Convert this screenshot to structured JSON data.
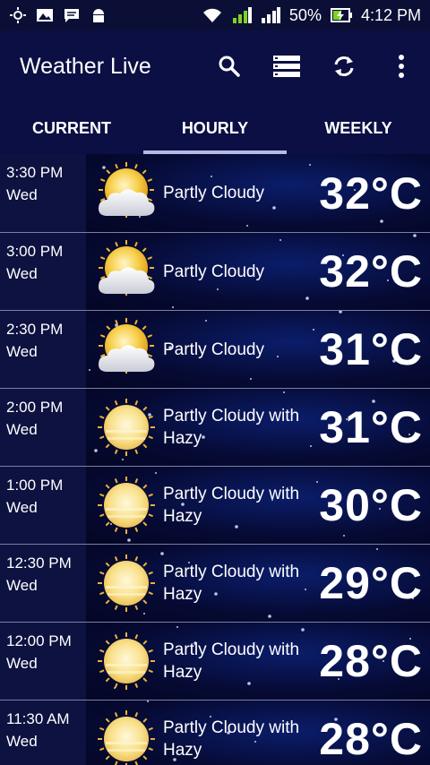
{
  "status_bar": {
    "battery": "50%",
    "time": "4:12 PM"
  },
  "app_bar": {
    "title": "Weather Live",
    "actions": [
      "search-icon",
      "list-icon",
      "refresh-icon",
      "more-vertical-icon"
    ]
  },
  "tabs": [
    {
      "label": "CURRENT",
      "active": false
    },
    {
      "label": "HOURLY",
      "active": true
    },
    {
      "label": "WEEKLY",
      "active": false
    }
  ],
  "hourly": [
    {
      "time": "3:30 PM",
      "day": "Wed",
      "condition": "Partly Cloudy",
      "temp": "32°C",
      "icon": "partly-cloudy-icon"
    },
    {
      "time": "3:00 PM",
      "day": "Wed",
      "condition": "Partly Cloudy",
      "temp": "32°C",
      "icon": "partly-cloudy-icon"
    },
    {
      "time": "2:30 PM",
      "day": "Wed",
      "condition": "Partly Cloudy",
      "temp": "31°C",
      "icon": "partly-cloudy-icon"
    },
    {
      "time": "2:00 PM",
      "day": "Wed",
      "condition": "Partly Cloudy with Hazy",
      "temp": "31°C",
      "icon": "hazy-sun-icon"
    },
    {
      "time": "1:00 PM",
      "day": "Wed",
      "condition": "Partly Cloudy with Hazy",
      "temp": "30°C",
      "icon": "hazy-sun-icon"
    },
    {
      "time": "12:30 PM",
      "day": "Wed",
      "condition": "Partly Cloudy with Hazy",
      "temp": "29°C",
      "icon": "hazy-sun-icon"
    },
    {
      "time": "12:00 PM",
      "day": "Wed",
      "condition": "Partly Cloudy with Hazy",
      "temp": "28°C",
      "icon": "hazy-sun-icon"
    },
    {
      "time": "11:30 AM",
      "day": "Wed",
      "condition": "Partly Cloudy with Hazy",
      "temp": "28°C",
      "icon": "hazy-sun-icon"
    }
  ],
  "colors": {
    "app_bar": "#0c0f43",
    "tab_indicator": "#b6b9e6",
    "battery": "#7ed321"
  }
}
